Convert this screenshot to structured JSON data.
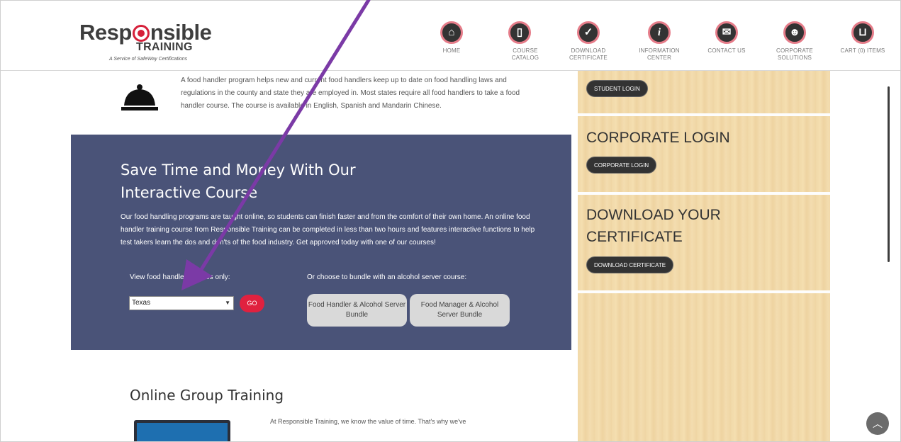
{
  "header": {
    "logo": {
      "main_pre": "Resp",
      "main_post": "nsible",
      "sub": "TRAINING",
      "tagline": "A Service of SafeWay Certifications"
    },
    "nav": [
      {
        "label": "HOME",
        "icon": "home-icon",
        "glyph": "⌂"
      },
      {
        "label": "COURSE CATALOG",
        "icon": "book-icon",
        "glyph": "▯"
      },
      {
        "label": "DOWNLOAD CERTIFICATE",
        "icon": "shield-check-icon",
        "glyph": "✓"
      },
      {
        "label": "INFORMATION CENTER",
        "icon": "info-icon",
        "glyph": "i"
      },
      {
        "label": "CONTACT US",
        "icon": "mail-icon",
        "glyph": "✉"
      },
      {
        "label": "CORPORATE SOLUTIONS",
        "icon": "group-icon",
        "glyph": "☻"
      },
      {
        "label": "CART (0) ITEMS",
        "icon": "cart-icon",
        "glyph": "⊔"
      }
    ]
  },
  "intro": {
    "text": "A food handler program helps new and current food handlers keep up to date on food handling laws and regulations in the county and state they are employed in. Most states require all food handlers to take a food handler course. The course is available in English, Spanish and Mandarin Chinese."
  },
  "save": {
    "heading": "Save Time and Money With Our Interactive Course",
    "body": "Our food handling programs are taught online, so students can finish faster and from the comfort of their own home. An online food handler training course from Responsible Training can be completed in less than two hours and features interactive functions to help test takers learn the dos and don'ts of the food industry. Get approved today with one of our courses!",
    "view_label": "View food handler courses only:",
    "bundle_label": "Or choose to bundle with an alcohol server course:",
    "state_value": "Texas",
    "go_label": "GO",
    "bundle1": "Food Handler & Alcohol Server Bundle",
    "bundle2": "Food Manager & Alcohol Server Bundle"
  },
  "online": {
    "heading": "Online Group Training",
    "text": "At Responsible Training, we know the value of time. That's why we've"
  },
  "sidebar": {
    "student_login_button": "STUDENT LOGIN",
    "corporate_heading": "CORPORATE LOGIN",
    "corporate_login_button": "CORPORATE LOGIN",
    "download_heading_line1": "DOWNLOAD YOUR",
    "download_heading_line2": "CERTIFICATE",
    "download_button": "DOWNLOAD CERTIFICATE"
  },
  "colors": {
    "accent_red": "#e0213f",
    "panel_blue": "#4a5378",
    "arrow_purple": "#7b3aa6"
  }
}
